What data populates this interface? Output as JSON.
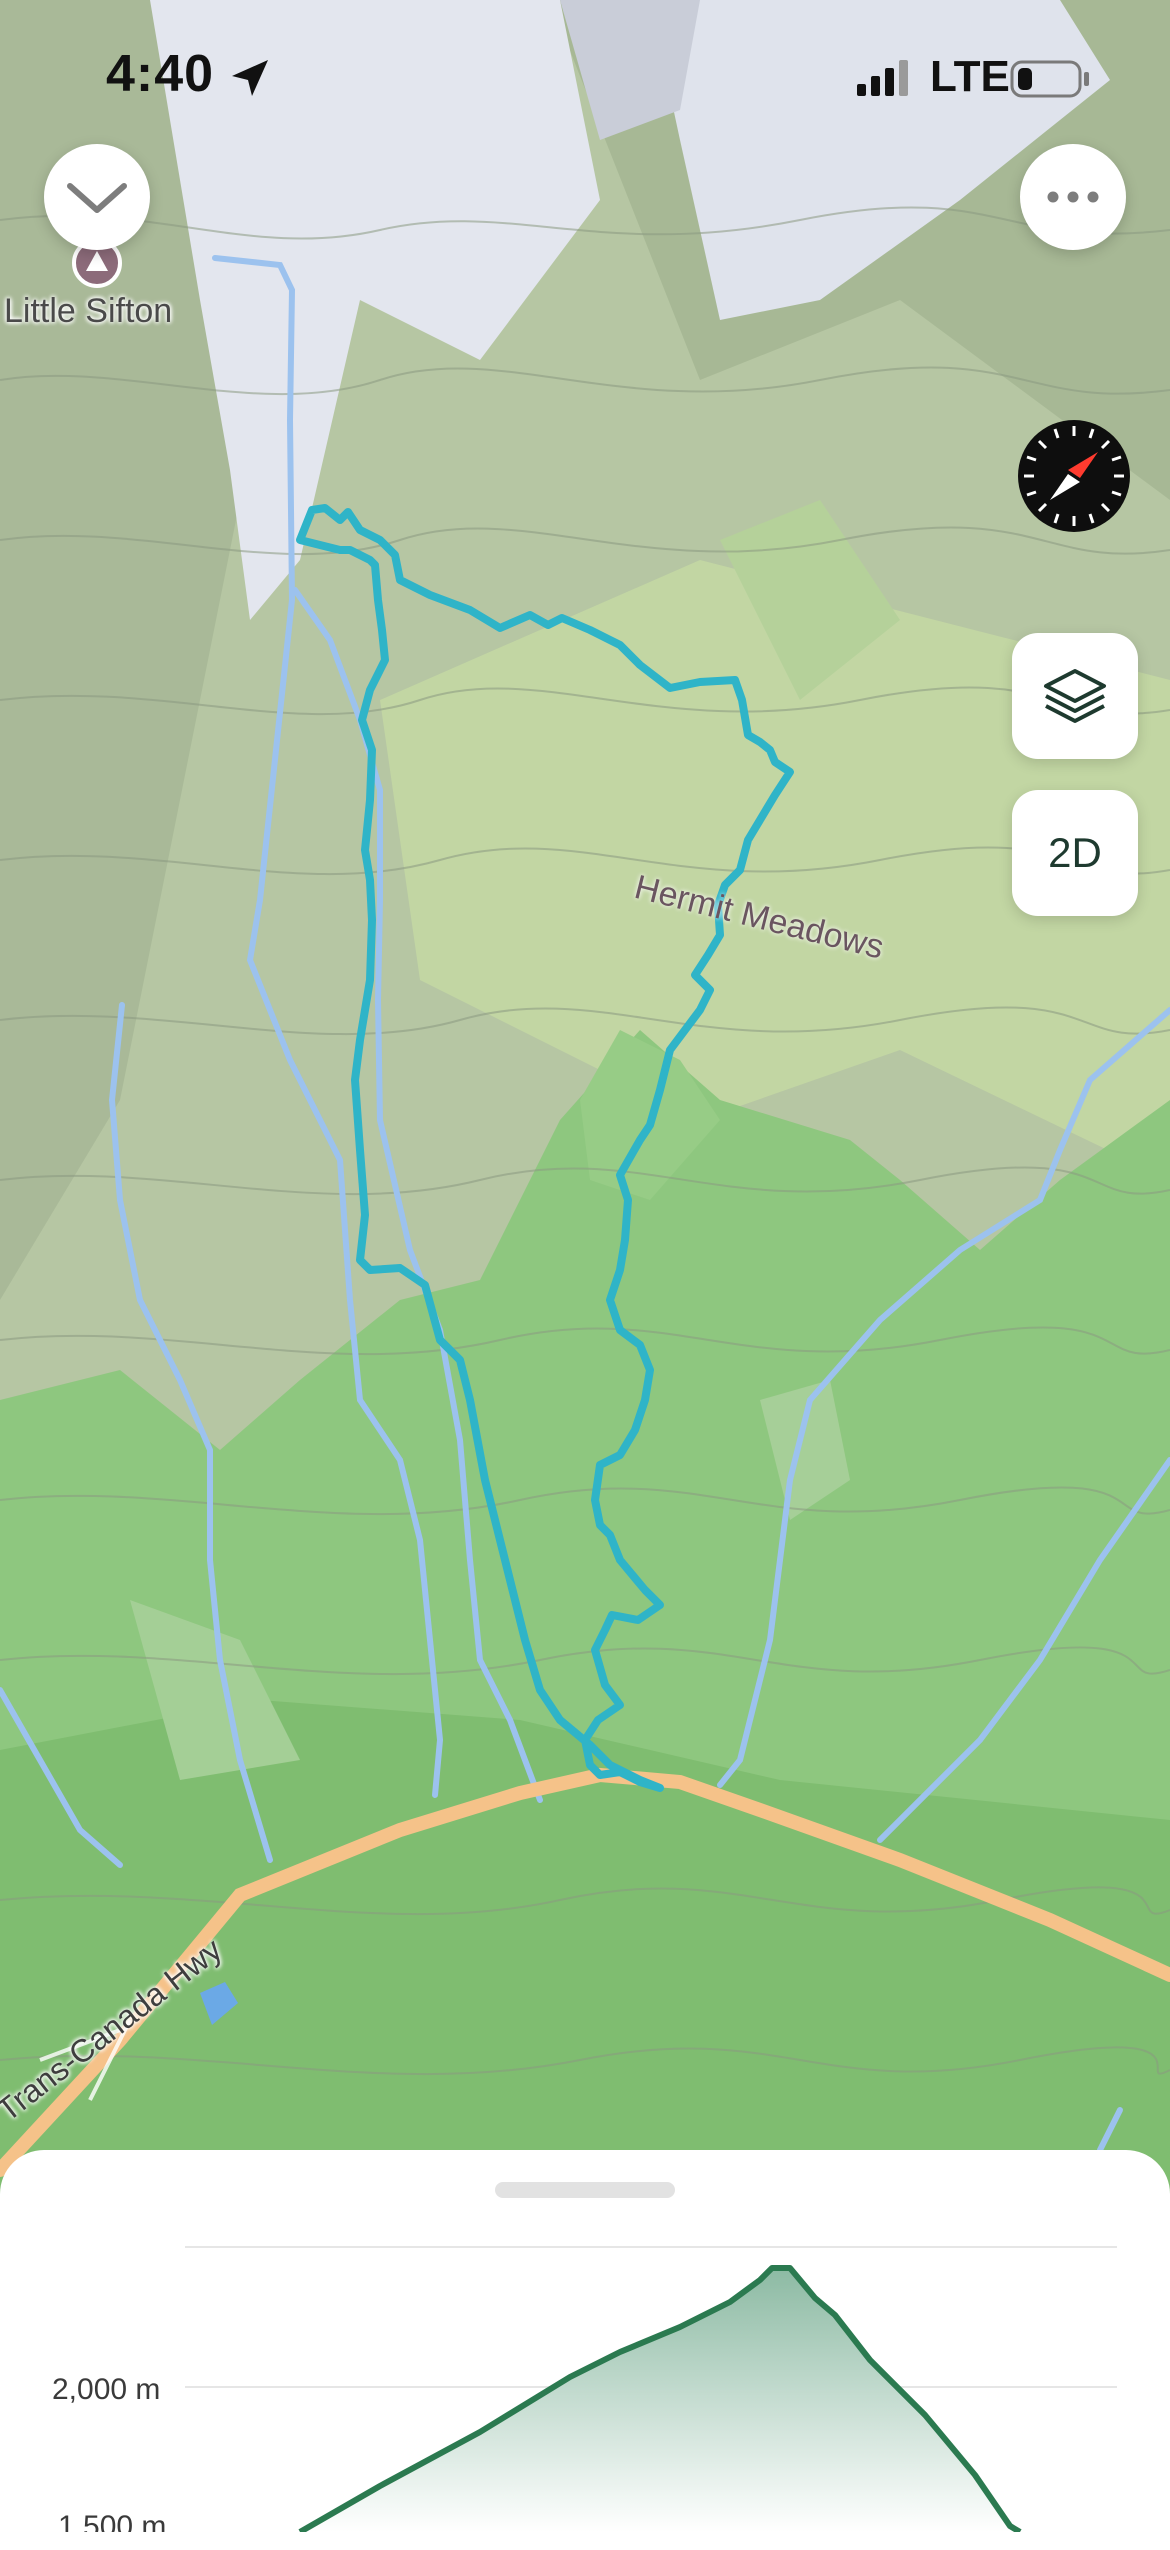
{
  "status_bar": {
    "time": "4:40",
    "network": "LTE",
    "icons": [
      "location-arrow-icon",
      "signal-bars-icon",
      "battery-icon"
    ]
  },
  "map": {
    "labels": {
      "peak": "Little Sifton",
      "meadow": "Hermit Meadows",
      "highway": "Trans-Canada Hwy"
    },
    "view_mode_button": "2D",
    "icons": [
      "chevron-down-icon",
      "more-icon",
      "compass-icon",
      "layers-icon",
      "peak-marker-icon"
    ],
    "colors": {
      "route": "#2fb4c8",
      "highway": "#f5c289",
      "forest": "#8ec77f",
      "snow": "#e3e6ee",
      "stream": "#9cc2ee"
    }
  },
  "elevation_profile": {
    "y_ticks": [
      "2,000 m",
      "1,500 m"
    ],
    "colors": {
      "line": "#2b7a50",
      "fill_top": "#8cbaa3",
      "fill_bottom": "#ffffff"
    }
  }
}
